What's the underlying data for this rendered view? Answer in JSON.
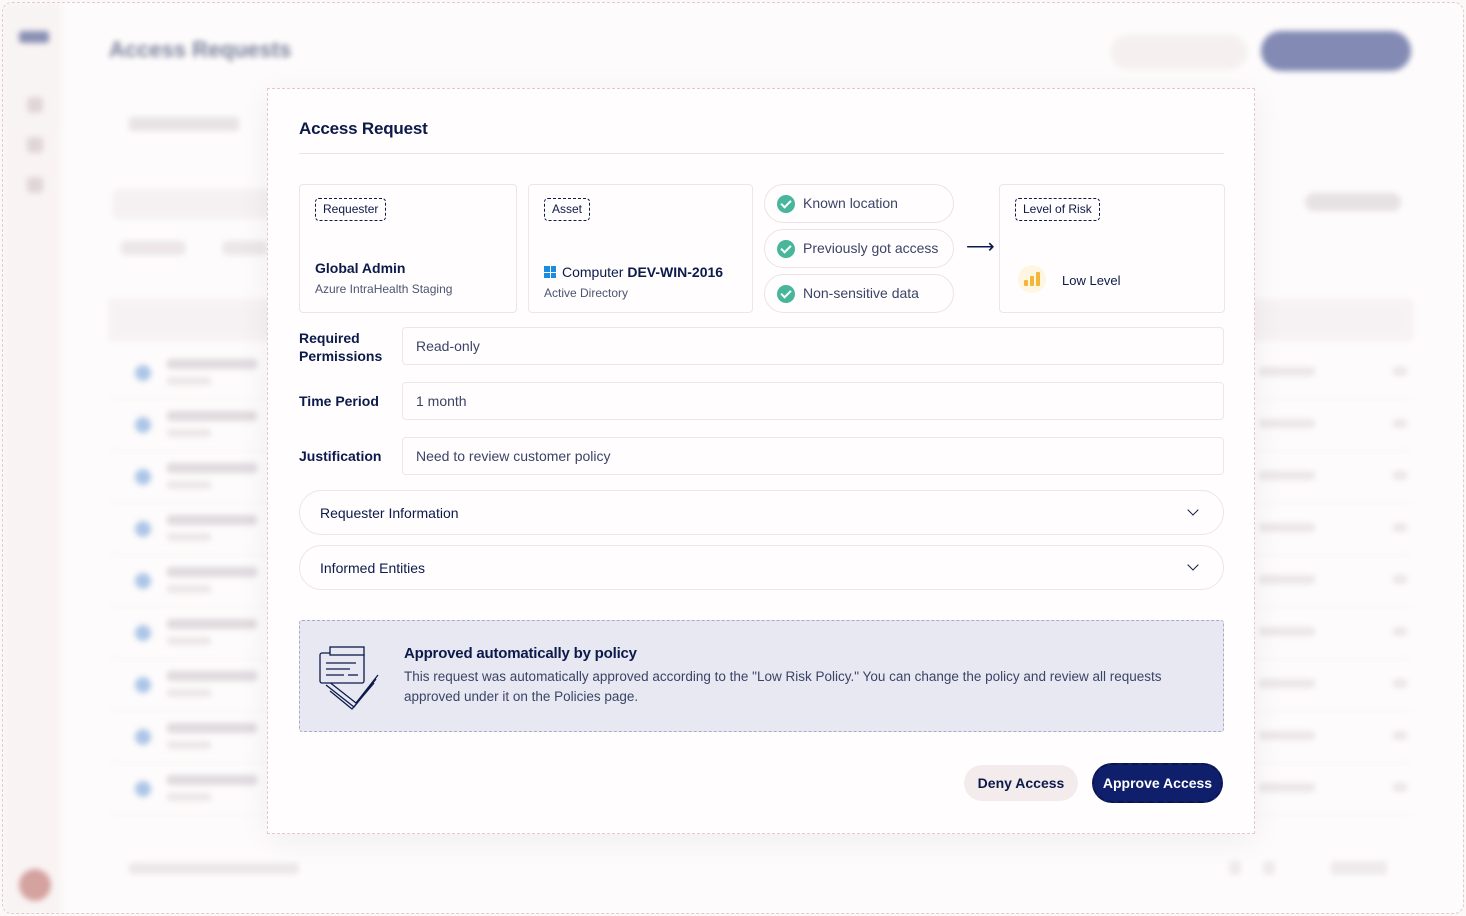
{
  "background": {
    "page_title": "Access Requests"
  },
  "modal": {
    "title": "Access Request",
    "requester": {
      "tag": "Requester",
      "name": "Global Admin",
      "org": "Azure IntraHealth Staging"
    },
    "asset": {
      "tag": "Asset",
      "type": "Computer",
      "name": "DEV-WIN-2016",
      "source": "Active Directory"
    },
    "checks": [
      {
        "label": "Known location"
      },
      {
        "label": "Previously got access"
      },
      {
        "label": "Non-sensitive data"
      }
    ],
    "risk": {
      "tag": "Level of Risk",
      "value": "Low Level"
    },
    "fields": {
      "permissions": {
        "label": "Required Permissions",
        "value": "Read-only"
      },
      "time_period": {
        "label": "Time Period",
        "value": "1 month"
      },
      "justification": {
        "label": "Justification",
        "value": "Need to review customer policy"
      }
    },
    "accordions": {
      "requester_info": "Requester Information",
      "informed_entities": "Informed Entities"
    },
    "policy": {
      "title": "Approved automatically by policy",
      "text": "This request was automatically approved according to the \"Low Risk Policy.\" You can change the policy and review all requests approved under it on the Policies page."
    },
    "actions": {
      "deny": "Deny Access",
      "approve": "Approve Access"
    }
  },
  "colors": {
    "navy": "#0b1a4a",
    "primary_button": "#0f1f6b",
    "check_green": "#48b69a",
    "risk_yellow": "#f3b53a",
    "policy_bg": "#e7e8f1"
  }
}
